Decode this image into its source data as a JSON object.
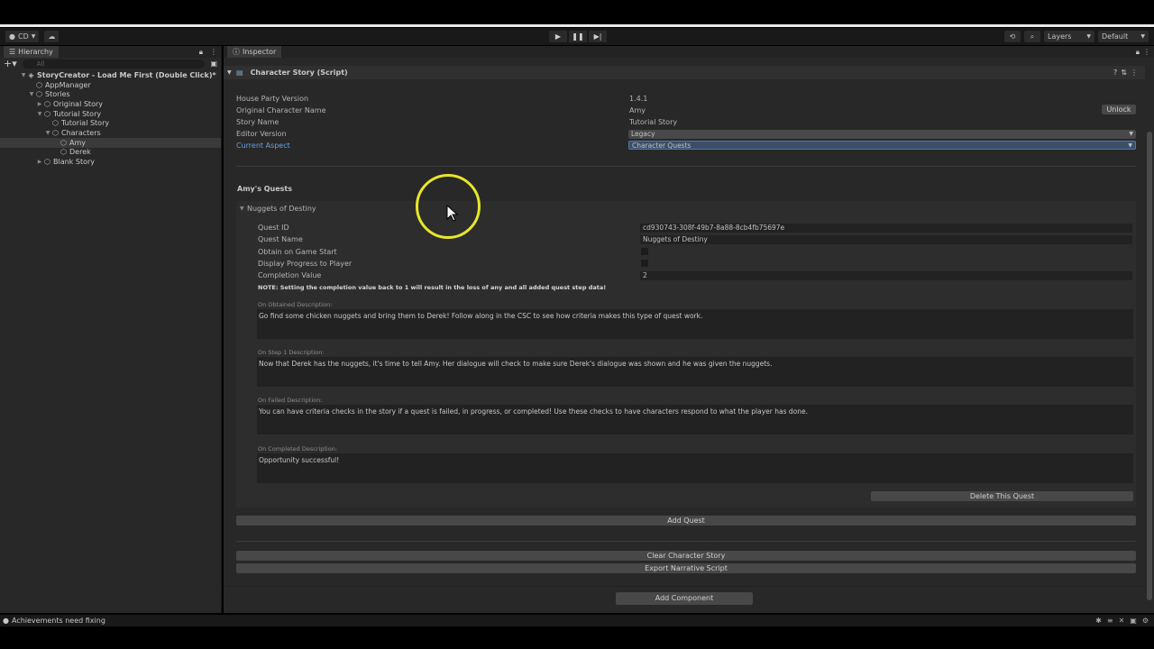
{
  "toolbar": {
    "account": "CD",
    "layers": "Layers",
    "layout": "Default"
  },
  "hierarchy": {
    "tab_label": "Hierarchy",
    "search_placeholder": "All",
    "items": [
      {
        "label": "StoryCreator - Load Me First (Double Click)*",
        "indent": 0,
        "arrow": "▼",
        "bold": true
      },
      {
        "label": "AppManager",
        "indent": 1,
        "arrow": ""
      },
      {
        "label": "Stories",
        "indent": 1,
        "arrow": "▼"
      },
      {
        "label": "Original Story",
        "indent": 2,
        "arrow": "▶"
      },
      {
        "label": "Tutorial Story",
        "indent": 2,
        "arrow": "▼"
      },
      {
        "label": "Tutorial Story",
        "indent": 3,
        "arrow": ""
      },
      {
        "label": "Characters",
        "indent": 3,
        "arrow": "▼"
      },
      {
        "label": "Amy",
        "indent": 4,
        "arrow": "",
        "selected": true
      },
      {
        "label": "Derek",
        "indent": 4,
        "arrow": ""
      },
      {
        "label": "Blank Story",
        "indent": 2,
        "arrow": "▶"
      }
    ]
  },
  "inspector": {
    "tab_label": "Inspector",
    "component_title": "Character Story (Script)",
    "props": {
      "house_party_version_label": "House Party Version",
      "house_party_version": "1.4.1",
      "original_name_label": "Original Character Name",
      "original_name": "Amy",
      "unlock_button": "Unlock",
      "story_name_label": "Story Name",
      "story_name": "Tutorial Story",
      "editor_version_label": "Editor Version",
      "editor_version": "Legacy",
      "current_aspect_label": "Current Aspect",
      "current_aspect": "Character Quests"
    },
    "quests_header": "Amy's Quests",
    "quest": {
      "foldout_label": "Nuggets of Destiny",
      "id_label": "Quest ID",
      "id": "cd930743-308f-49b7-8a88-8cb4fb75697e",
      "name_label": "Quest Name",
      "name": "Nuggets of Destiny",
      "obtain_label": "Obtain on Game Start",
      "obtain": false,
      "progress_label": "Display Progress to Player",
      "progress": false,
      "completion_label": "Completion Value",
      "completion": "2",
      "note": "NOTE: Setting the completion value back to 1 will result in the loss of any and all added quest step data!",
      "obtained_desc_label": "On Obtained Description:",
      "obtained_desc": "Go find some chicken nuggets and bring them to Derek! Follow along in the CSC to see how criteria makes this type of quest work.",
      "step1_desc_label": "On Step 1 Description:",
      "step1_desc": "Now that Derek has the nuggets, it's time to tell Amy. Her dialogue will check to make sure Derek's dialogue was shown and he was given the nuggets.",
      "failed_desc_label": "On Failed Description:",
      "failed_desc": "You can have criteria checks in the story if a quest is failed, in progress, or completed! Use these checks to have characters respond to what the player has done.",
      "completed_desc_label": "On Completed Description:",
      "completed_desc": "Opportunity successful!",
      "delete_button": "Delete This Quest"
    },
    "add_quest_button": "Add Quest",
    "clear_button": "Clear Character Story",
    "export_button": "Export Narrative Script",
    "add_component_button": "Add Component"
  },
  "status": {
    "message": "Achievements need fixing"
  }
}
